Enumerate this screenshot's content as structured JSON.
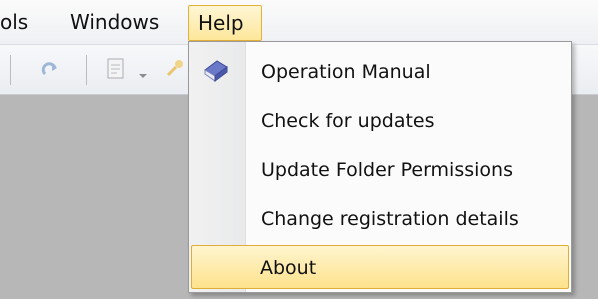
{
  "menubar": {
    "items": [
      {
        "label": "ols"
      },
      {
        "label": "Windows"
      },
      {
        "label": "Help"
      }
    ]
  },
  "help_menu": {
    "items": [
      {
        "label": "Operation Manual",
        "icon": "book-icon"
      },
      {
        "label": "Check for updates"
      },
      {
        "label": "Update Folder Permissions"
      },
      {
        "label": "Change registration details"
      },
      {
        "label": "About",
        "highlighted": true
      }
    ]
  },
  "toolbar": {
    "icons": [
      "redo-icon",
      "document-icon",
      "dropdown-arrow-icon",
      "key-icon"
    ]
  },
  "colors": {
    "highlight": "#fde28c",
    "highlight_border": "#e2ad37",
    "workspace": "#b7b7b7"
  }
}
